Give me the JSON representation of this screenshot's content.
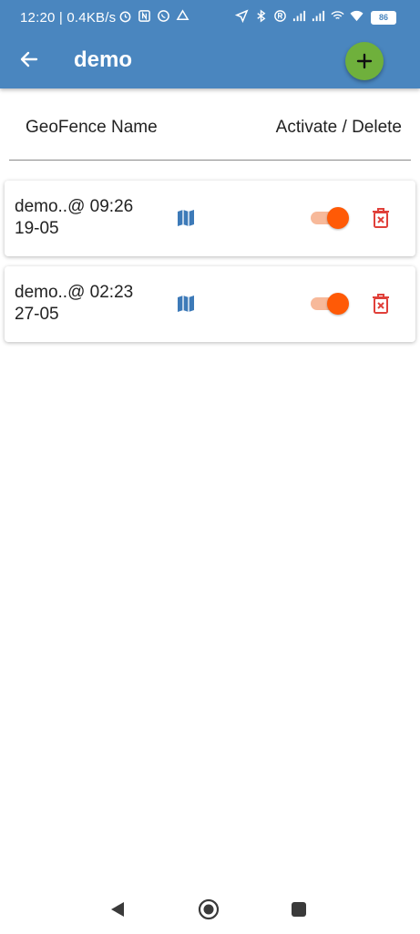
{
  "status_bar": {
    "time": "12:20 | 0.4KB/s",
    "battery": "86"
  },
  "app_bar": {
    "title": "demo",
    "back_icon": "arrow-back-icon",
    "add_icon": "plus-icon"
  },
  "list_header": {
    "name_col": "GeoFence Name",
    "action_col": "Activate / Delete"
  },
  "geofences": [
    {
      "name": "demo..@ 09:26 19-05",
      "active": true
    },
    {
      "name": "demo..@ 02:23 27-05",
      "active": true
    }
  ],
  "colors": {
    "app_bar": "#4a86bf",
    "fab": "#6fb03c",
    "toggle_thumb": "#ff5a06",
    "toggle_track": "#f7b99a",
    "map_icon": "#3d7ab8",
    "delete_icon": "#e0403a"
  }
}
